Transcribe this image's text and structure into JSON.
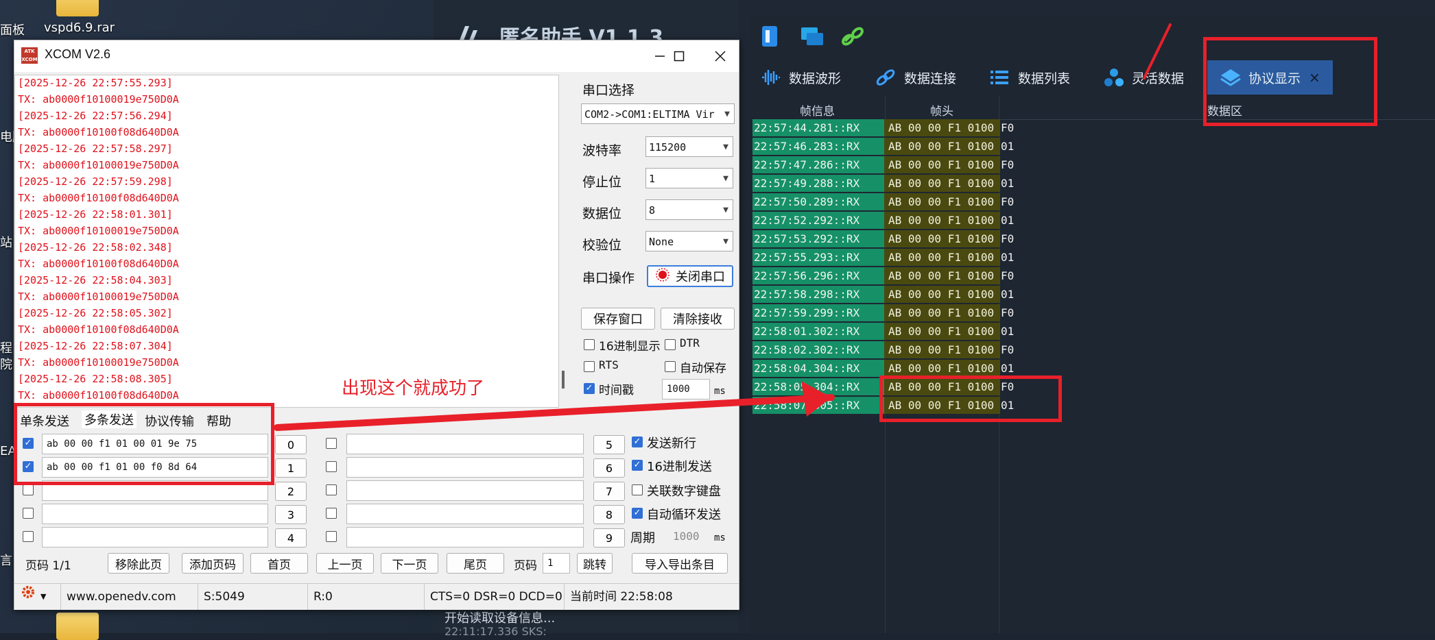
{
  "desktop": {
    "icons": [
      "面板",
      "vspd6.9.rar"
    ],
    "edge_labels": [
      "电脑",
      "站",
      "程",
      "院",
      "EA",
      "言"
    ]
  },
  "nm_app": {
    "title": "匿名助手  V1.1.3",
    "tabs": [
      {
        "label": "数据波形",
        "icon": "waveform-icon"
      },
      {
        "label": "数据连接",
        "icon": "link-icon"
      },
      {
        "label": "数据列表",
        "icon": "list-icon"
      },
      {
        "label": "灵活数据",
        "icon": "cubes-icon"
      },
      {
        "label": "协议显示",
        "icon": "layers-icon",
        "active": true,
        "close": "×"
      }
    ],
    "columns": [
      "帧信息",
      "帧头",
      "数据区"
    ],
    "rows": [
      {
        "time": "22:57:44.281::RX",
        "head": "AB 00 00 F1 0100",
        "data": "F0"
      },
      {
        "time": "22:57:46.283::RX",
        "head": "AB 00 00 F1 0100",
        "data": "01"
      },
      {
        "time": "22:57:47.286::RX",
        "head": "AB 00 00 F1 0100",
        "data": "F0"
      },
      {
        "time": "22:57:49.288::RX",
        "head": "AB 00 00 F1 0100",
        "data": "01"
      },
      {
        "time": "22:57:50.289::RX",
        "head": "AB 00 00 F1 0100",
        "data": "F0"
      },
      {
        "time": "22:57:52.292::RX",
        "head": "AB 00 00 F1 0100",
        "data": "01"
      },
      {
        "time": "22:57:53.292::RX",
        "head": "AB 00 00 F1 0100",
        "data": "F0"
      },
      {
        "time": "22:57:55.293::RX",
        "head": "AB 00 00 F1 0100",
        "data": "01"
      },
      {
        "time": "22:57:56.296::RX",
        "head": "AB 00 00 F1 0100",
        "data": "F0"
      },
      {
        "time": "22:57:58.298::RX",
        "head": "AB 00 00 F1 0100",
        "data": "01"
      },
      {
        "time": "22:57:59.299::RX",
        "head": "AB 00 00 F1 0100",
        "data": "F0"
      },
      {
        "time": "22:58:01.302::RX",
        "head": "AB 00 00 F1 0100",
        "data": "01"
      },
      {
        "time": "22:58:02.302::RX",
        "head": "AB 00 00 F1 0100",
        "data": "F0"
      },
      {
        "time": "22:58:04.304::RX",
        "head": "AB 00 00 F1 0100",
        "data": "01"
      },
      {
        "time": "22:58:05.304::RX",
        "head": "AB 00 00 F1 0100",
        "data": "F0"
      },
      {
        "time": "22:58:07.305::RX",
        "head": "AB 00 00 F1 0100",
        "data": "01"
      }
    ],
    "status_lines": [
      "开始读取设备信息...",
      "22:11:17.336 SKS:"
    ]
  },
  "xcom": {
    "title": "XCOM V2.6",
    "logo_text": "ATK XCOM",
    "rx_lines": [
      "[2025-12-26 22:57:55.293]",
      "TX: ab0000f10100019e750D0A",
      "[2025-12-26 22:57:56.294]",
      "TX: ab0000f10100f08d640D0A",
      "[2025-12-26 22:57:58.297]",
      "TX: ab0000f10100019e750D0A",
      "[2025-12-26 22:57:59.298]",
      "TX: ab0000f10100f08d640D0A",
      "[2025-12-26 22:58:01.301]",
      "TX: ab0000f10100019e750D0A",
      "[2025-12-26 22:58:02.348]",
      "TX: ab0000f10100f08d640D0A",
      "[2025-12-26 22:58:04.303]",
      "TX: ab0000f10100019e750D0A",
      "[2025-12-26 22:58:05.302]",
      "TX: ab0000f10100f08d640D0A",
      "[2025-12-26 22:58:07.304]",
      "TX: ab0000f10100019e750D0A",
      "[2025-12-26 22:58:08.305]",
      "TX: ab0000f10100f08d640D0A"
    ],
    "side": {
      "port_select_label": "串口选择",
      "port_value": "COM2->COM1:ELTIMA Vir",
      "baud_label": "波特率",
      "baud_value": "115200",
      "stop_label": "停止位",
      "stop_value": "1",
      "data_label": "数据位",
      "data_value": "8",
      "parity_label": "校验位",
      "parity_value": "None",
      "op_label": "串口操作",
      "close_port": "关闭串口",
      "save_window": "保存窗口",
      "clear_recv": "清除接收",
      "hex_display": "16进制显示",
      "dtr": "DTR",
      "rts": "RTS",
      "auto_save": "自动保存",
      "timestamp": "时间戳",
      "timestamp_value": "1000",
      "ms": "ms"
    },
    "tabs": [
      "单条发送",
      "多条发送",
      "协议传输",
      "帮助"
    ],
    "multi_left": [
      {
        "checked": true,
        "text": "ab 00 00 f1 01 00 01 9e 75",
        "num": "0"
      },
      {
        "checked": true,
        "text": "ab 00 00 f1 01 00 f0 8d 64",
        "num": "1"
      },
      {
        "checked": false,
        "text": "",
        "num": "2"
      },
      {
        "checked": false,
        "text": "",
        "num": "3"
      },
      {
        "checked": false,
        "text": "",
        "num": "4"
      }
    ],
    "multi_right": [
      {
        "checked": false,
        "text": "",
        "num": "5"
      },
      {
        "checked": false,
        "text": "",
        "num": "6"
      },
      {
        "checked": false,
        "text": "",
        "num": "7"
      },
      {
        "checked": false,
        "text": "",
        "num": "8"
      },
      {
        "checked": false,
        "text": "",
        "num": "9"
      }
    ],
    "options": {
      "send_newline": "发送新行",
      "hex_send": "16进制发送",
      "link_keypad": "关联数字键盘",
      "auto_loop": "自动循环发送",
      "period_label": "周期",
      "period_value": "1000",
      "ms": "ms"
    },
    "pager": {
      "page_label": "页码 1/1",
      "remove_page": "移除此页",
      "add_page": "添加页码",
      "first": "首页",
      "prev": "上一页",
      "next": "下一页",
      "last": "尾页",
      "page_num_label": "页码",
      "page_num_value": "1",
      "jump": "跳转",
      "import_export": "导入导出条目"
    },
    "statusbar": {
      "url": "www.openedv.com",
      "sent": "S:5049",
      "recv": "R:0",
      "lines": "CTS=0 DSR=0 DCD=0",
      "time": "当前时间 22:58:08"
    }
  },
  "annotation": {
    "text": "出现这个就成功了",
    "color": "#e8202a"
  }
}
